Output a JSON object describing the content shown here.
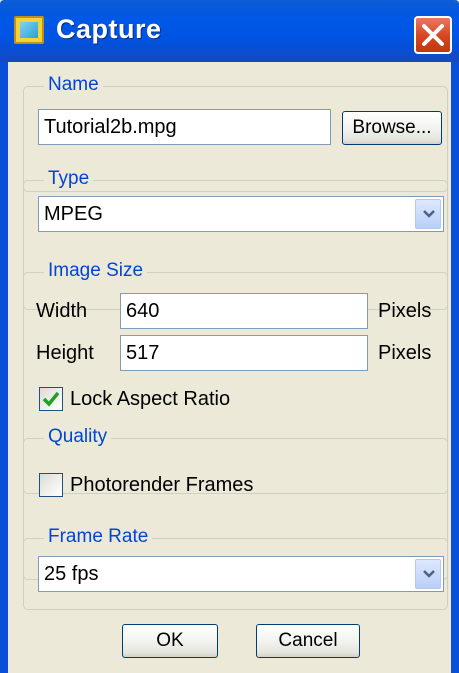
{
  "window": {
    "title": "Capture",
    "icon": "capture-app-icon",
    "close_icon": "close-icon"
  },
  "name_group": {
    "label": "Name",
    "filename": "Tutorial2b.mpg",
    "browse_label": "Browse..."
  },
  "type_group": {
    "label": "Type",
    "selected": "MPEG"
  },
  "image_size_group": {
    "label": "Image Size",
    "width_label": "Width",
    "width_value": "640",
    "width_unit": "Pixels",
    "height_label": "Height",
    "height_value": "517",
    "height_unit": "Pixels",
    "lock_aspect_label": "Lock Aspect Ratio",
    "lock_aspect_checked": true
  },
  "quality_group": {
    "label": "Quality",
    "photorender_label": "Photorender Frames",
    "photorender_checked": false
  },
  "frame_rate_group": {
    "label": "Frame Rate",
    "selected": "25 fps"
  },
  "buttons": {
    "ok_label": "OK",
    "cancel_label": "Cancel"
  },
  "colors": {
    "titlebar": "#0054e3",
    "group_label": "#0046d5",
    "check_mark": "#21a121",
    "close_button": "#d6451e"
  }
}
